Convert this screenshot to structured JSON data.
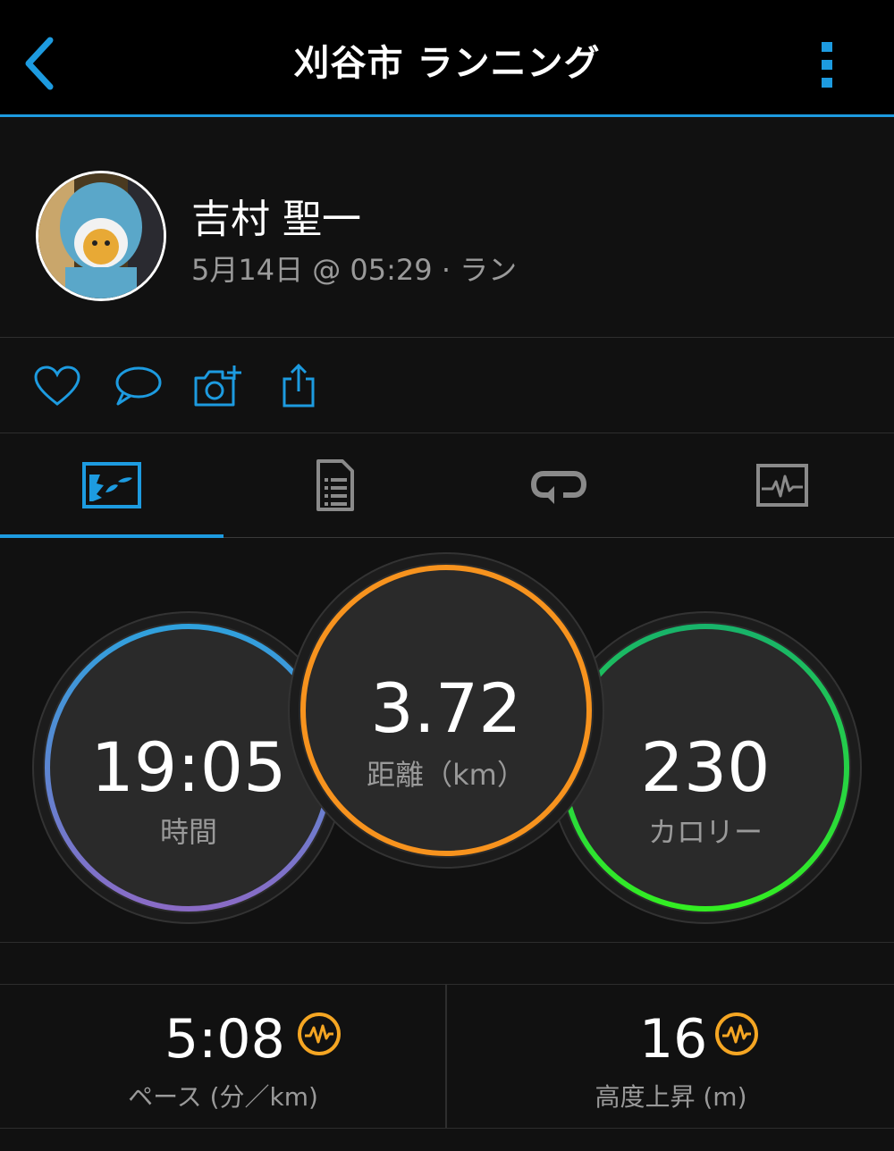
{
  "header": {
    "title": "刈谷市 ランニング",
    "back_icon": "chevron-left-icon",
    "more_icon": "kebab-menu-icon"
  },
  "profile": {
    "name": "吉村 聖一",
    "meta": "5月14日 @ 05:29 · ラン"
  },
  "actions": [
    "heart-icon",
    "comment-icon",
    "add-photo-icon",
    "share-icon"
  ],
  "tabs": [
    {
      "icon": "map-overview-icon",
      "active": true
    },
    {
      "icon": "details-list-icon",
      "active": false
    },
    {
      "icon": "laps-icon",
      "active": false
    },
    {
      "icon": "charts-icon",
      "active": false
    }
  ],
  "summary": {
    "time": {
      "value": "19:05",
      "label": "時間"
    },
    "distance": {
      "value": "3.72",
      "label": "距離（km）"
    },
    "calories": {
      "value": "230",
      "label": "カロリー"
    }
  },
  "stats": {
    "pace": {
      "value": "5:08",
      "label": "ペース (分／km)"
    },
    "elevation": {
      "value": "16",
      "label": "高度上昇 (m)"
    }
  },
  "colors": {
    "accent": "#1d9be0",
    "time_ring_start": "#2fa1dd",
    "time_ring_end": "#8a6bc6",
    "distance_ring": "#f7931e",
    "calories_ring_start": "#18b36a",
    "calories_ring_end": "#33ee22",
    "badge": "#f5a623"
  }
}
